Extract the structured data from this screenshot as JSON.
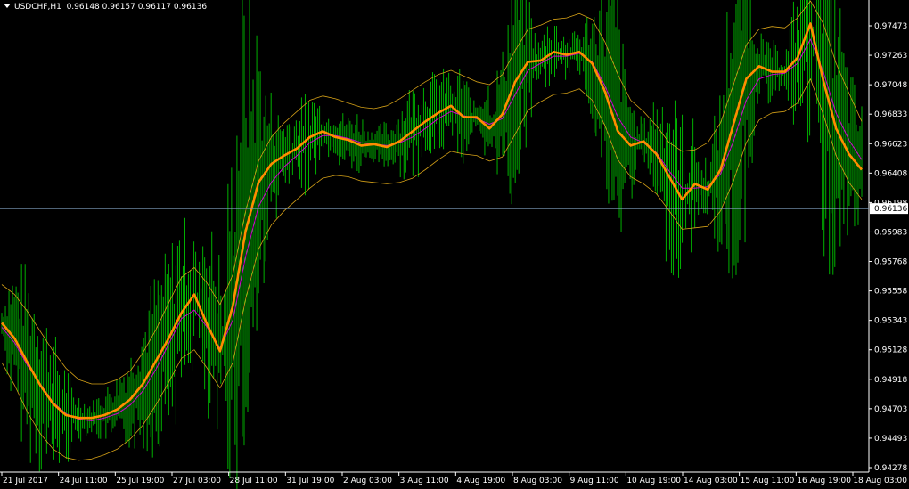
{
  "header": {
    "symbol": "USDCHF,H1",
    "open": "0.96148",
    "high": "0.96157",
    "low": "0.96117",
    "close": "0.96136"
  },
  "colors": {
    "background": "#000000",
    "bars": "#00b000",
    "ma_fast": "#ff8c00",
    "ma_mid": "#d000d0",
    "envelope": "#d4a017",
    "bid_line": "#7f9fbf",
    "axis": "#ffffff"
  },
  "chart_data": {
    "type": "line",
    "title": "USDCHF,H1",
    "ylim": [
      0.94278,
      0.976
    ],
    "y_ticks": [
      "0.97473",
      "0.97263",
      "0.97048",
      "0.96833",
      "0.96623",
      "0.96408",
      "0.96198",
      "0.95983",
      "0.95768",
      "0.95558",
      "0.95343",
      "0.95128",
      "0.94918",
      "0.94703",
      "0.94493",
      "0.94278"
    ],
    "x_ticks": [
      "21 Jul 2017",
      "24 Jul 11:00",
      "25 Jul 19:00",
      "27 Jul 03:00",
      "28 Jul 11:00",
      "31 Jul 19:00",
      "2 Aug 03:00",
      "3 Aug 11:00",
      "4 Aug 19:00",
      "8 Aug 03:00",
      "9 Aug 11:00",
      "10 Aug 19:00",
      "14 Aug 03:00",
      "15 Aug 11:00",
      "16 Aug 19:00",
      "18 Aug 03:00"
    ],
    "current_price": "0.96136",
    "current_price_value": 0.96136,
    "series": [
      {
        "key": "ma_fast",
        "values": [
          0.9533,
          0.9522,
          0.9505,
          0.9489,
          0.9476,
          0.9468,
          0.9466,
          0.9466,
          0.9468,
          0.9472,
          0.9479,
          0.949,
          0.9506,
          0.9522,
          0.954,
          0.9553,
          0.9532,
          0.9513,
          0.9545,
          0.9598,
          0.9632,
          0.9645,
          0.9651,
          0.9656,
          0.9664,
          0.9668,
          0.9664,
          0.9662,
          0.9658,
          0.9659,
          0.9657,
          0.9661,
          0.9668,
          0.9675,
          0.9681,
          0.9686,
          0.9678,
          0.9678,
          0.967,
          0.968,
          0.9703,
          0.9717,
          0.9718,
          0.9724,
          0.9722,
          0.9724,
          0.9716,
          0.9696,
          0.9668,
          0.9658,
          0.9661,
          0.9652,
          0.9636,
          0.962,
          0.9631,
          0.9627,
          0.9641,
          0.9673,
          0.9705,
          0.9714,
          0.971,
          0.971,
          0.972,
          0.9744,
          0.9704,
          0.967,
          0.9652,
          0.9641
        ]
      },
      {
        "key": "ma_mid",
        "values": [
          0.953,
          0.9519,
          0.9503,
          0.949,
          0.9477,
          0.9469,
          0.9465,
          0.9464,
          0.9466,
          0.9469,
          0.9475,
          0.9485,
          0.95,
          0.9518,
          0.9536,
          0.9542,
          0.953,
          0.9515,
          0.9535,
          0.958,
          0.9615,
          0.9632,
          0.9643,
          0.9651,
          0.966,
          0.9665,
          0.9665,
          0.9663,
          0.966,
          0.9659,
          0.9658,
          0.966,
          0.9664,
          0.967,
          0.9677,
          0.9682,
          0.9679,
          0.9677,
          0.9673,
          0.9677,
          0.9694,
          0.9711,
          0.9716,
          0.9721,
          0.9721,
          0.9723,
          0.9717,
          0.97,
          0.9678,
          0.9664,
          0.966,
          0.9653,
          0.964,
          0.9628,
          0.9628,
          0.9629,
          0.9638,
          0.9661,
          0.969,
          0.9705,
          0.9708,
          0.9709,
          0.9716,
          0.9733,
          0.971,
          0.9681,
          0.9662,
          0.9648
        ]
      },
      {
        "key": "env_upper",
        "values": [
          0.956,
          0.9553,
          0.9541,
          0.9527,
          0.9513,
          0.9501,
          0.9493,
          0.949,
          0.949,
          0.9493,
          0.9499,
          0.9512,
          0.9528,
          0.9547,
          0.9565,
          0.9572,
          0.9561,
          0.9546,
          0.9567,
          0.9612,
          0.9647,
          0.9664,
          0.9674,
          0.9682,
          0.969,
          0.9693,
          0.9691,
          0.9688,
          0.9685,
          0.9684,
          0.9686,
          0.9691,
          0.9697,
          0.9703,
          0.9708,
          0.9711,
          0.9707,
          0.9703,
          0.9701,
          0.9708,
          0.9725,
          0.974,
          0.9743,
          0.9747,
          0.9748,
          0.9751,
          0.9747,
          0.9731,
          0.9708,
          0.969,
          0.9682,
          0.9672,
          0.966,
          0.9654,
          0.9655,
          0.966,
          0.9674,
          0.9701,
          0.9729,
          0.974,
          0.9742,
          0.9741,
          0.9748,
          0.976,
          0.9744,
          0.9716,
          0.9695,
          0.9675
        ]
      },
      {
        "key": "env_lower",
        "values": [
          0.9505,
          0.9489,
          0.947,
          0.9455,
          0.9444,
          0.9438,
          0.9436,
          0.9437,
          0.944,
          0.9444,
          0.9451,
          0.9461,
          0.9475,
          0.9491,
          0.9508,
          0.9514,
          0.9501,
          0.9487,
          0.9505,
          0.955,
          0.9585,
          0.9602,
          0.9612,
          0.962,
          0.9628,
          0.9635,
          0.9637,
          0.9636,
          0.9633,
          0.9632,
          0.9631,
          0.9632,
          0.9635,
          0.9641,
          0.9648,
          0.9654,
          0.9652,
          0.9651,
          0.9647,
          0.965,
          0.9666,
          0.9683,
          0.9689,
          0.9694,
          0.9695,
          0.9698,
          0.969,
          0.9672,
          0.9648,
          0.9636,
          0.9631,
          0.9624,
          0.9612,
          0.9599,
          0.96,
          0.9601,
          0.9612,
          0.9633,
          0.966,
          0.9676,
          0.9681,
          0.9682,
          0.9688,
          0.9705,
          0.968,
          0.9651,
          0.9632,
          0.962
        ]
      }
    ]
  }
}
